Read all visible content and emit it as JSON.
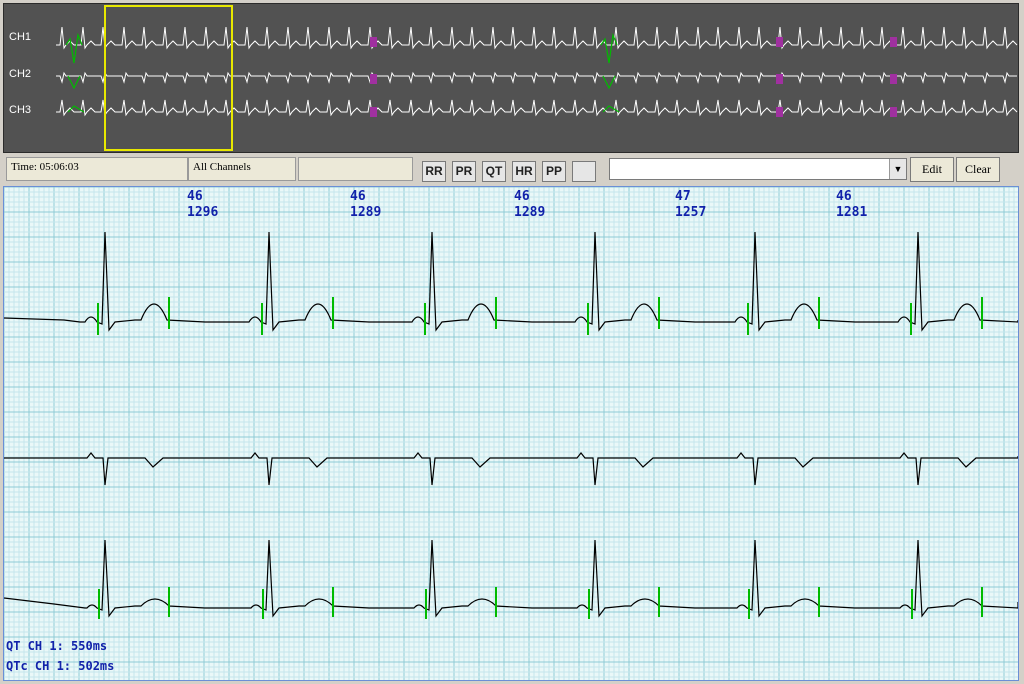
{
  "overview": {
    "channel_labels": [
      "CH1",
      "CH2",
      "CH3"
    ]
  },
  "toolbar": {
    "time_label": "Time: 05:06:03",
    "channel_select": "All Channels",
    "blank_field": "",
    "measure_buttons": [
      "RR",
      "PR",
      "QT",
      "HR",
      "PP",
      ""
    ],
    "note_value": "",
    "dropdown_icon": "chevron-down-icon",
    "edit_label": "Edit",
    "clear_label": "Clear"
  },
  "beat_measurements": [
    {
      "hr": "46",
      "rr": "1296"
    },
    {
      "hr": "46",
      "rr": "1289"
    },
    {
      "hr": "46",
      "rr": "1289"
    },
    {
      "hr": "47",
      "rr": "1257"
    },
    {
      "hr": "46",
      "rr": "1281"
    }
  ],
  "qt_readout": {
    "qt": "QT CH 1: 550ms",
    "qtc": "QTc CH 1: 502ms"
  },
  "colors": {
    "overview_bg": "#525252",
    "grid_bg": "#eaf8f8",
    "grid_minor": "#c4e6ec",
    "grid_major": "#8fcbd6",
    "marker_green": "#00bb00",
    "artifact_magenta": "#a030a0",
    "label_blue": "#1122aa",
    "selection_yellow": "#e8e800"
  }
}
